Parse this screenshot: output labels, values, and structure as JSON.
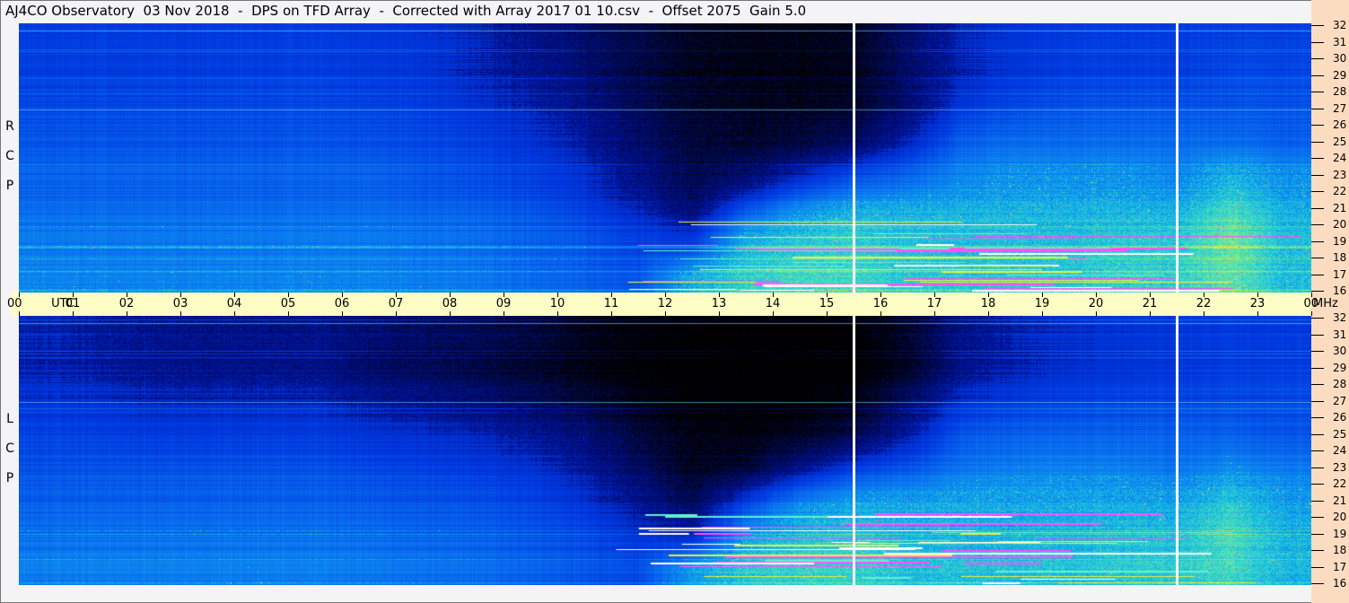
{
  "title": "AJ4CO Observatory  03 Nov 2018  -  DPS on TFD Array  -  Corrected with Array 2017 01 10.csv  -  Offset 2075  Gain 5.0",
  "chart_data": {
    "type": "heatmap",
    "title": "AJ4CO Observatory  03 Nov 2018  -  DPS on TFD Array  -  Corrected with Array 2017 01 10.csv  -  Offset 2075  Gain 5.0",
    "x_axis": {
      "label": "UTC",
      "range_hours": [
        0,
        24
      ],
      "ticks": [
        "00",
        "01",
        "02",
        "03",
        "04",
        "05",
        "06",
        "07",
        "08",
        "09",
        "10",
        "11",
        "12",
        "13",
        "14",
        "15",
        "16",
        "17",
        "18",
        "19",
        "20",
        "21",
        "22",
        "23",
        "00"
      ]
    },
    "y_axis": {
      "unit": "MHz",
      "range": [
        16,
        32
      ],
      "ticks": [
        "32",
        "31",
        "30",
        "29",
        "28",
        "27",
        "26",
        "25",
        "24",
        "23",
        "22",
        "21",
        "20",
        "19",
        "18",
        "17",
        "16"
      ]
    },
    "grid_freq_bands_mhz": [
      31,
      29,
      27,
      25,
      23,
      21,
      19,
      17
    ],
    "gap_markers_utc": [
      15.5,
      21.5
    ],
    "panels": [
      {
        "name": "RCP",
        "label": [
          "R",
          "C",
          "P"
        ],
        "intensity": [
          [
            0.35,
            0.35,
            0.35,
            0.35,
            0.35,
            0.35,
            0.34,
            0.33,
            0.3,
            0.25,
            0.2,
            0.15,
            0.1,
            0.08,
            0.08,
            0.1,
            0.2,
            0.3,
            0.33,
            0.35,
            0.35,
            0.35,
            0.36,
            0.36
          ],
          [
            0.36,
            0.36,
            0.36,
            0.36,
            0.36,
            0.36,
            0.35,
            0.34,
            0.3,
            0.27,
            0.22,
            0.15,
            0.1,
            0.08,
            0.08,
            0.1,
            0.2,
            0.3,
            0.34,
            0.36,
            0.36,
            0.36,
            0.38,
            0.38
          ],
          [
            0.38,
            0.38,
            0.38,
            0.38,
            0.38,
            0.38,
            0.37,
            0.36,
            0.33,
            0.3,
            0.25,
            0.18,
            0.12,
            0.1,
            0.1,
            0.12,
            0.22,
            0.35,
            0.38,
            0.4,
            0.4,
            0.4,
            0.4,
            0.4
          ],
          [
            0.4,
            0.4,
            0.4,
            0.4,
            0.4,
            0.4,
            0.39,
            0.38,
            0.36,
            0.33,
            0.28,
            0.2,
            0.14,
            0.12,
            0.14,
            0.2,
            0.3,
            0.42,
            0.44,
            0.44,
            0.44,
            0.44,
            0.44,
            0.42
          ],
          [
            0.42,
            0.42,
            0.42,
            0.42,
            0.42,
            0.42,
            0.42,
            0.4,
            0.38,
            0.36,
            0.32,
            0.24,
            0.16,
            0.2,
            0.3,
            0.38,
            0.42,
            0.48,
            0.5,
            0.5,
            0.5,
            0.48,
            0.55,
            0.5
          ],
          [
            0.44,
            0.44,
            0.44,
            0.44,
            0.44,
            0.44,
            0.44,
            0.43,
            0.42,
            0.4,
            0.36,
            0.3,
            0.22,
            0.4,
            0.5,
            0.55,
            0.55,
            0.56,
            0.56,
            0.56,
            0.56,
            0.55,
            0.65,
            0.55
          ],
          [
            0.46,
            0.46,
            0.46,
            0.46,
            0.46,
            0.46,
            0.46,
            0.45,
            0.44,
            0.42,
            0.4,
            0.36,
            0.35,
            0.55,
            0.6,
            0.62,
            0.58,
            0.58,
            0.58,
            0.58,
            0.6,
            0.6,
            0.7,
            0.58
          ],
          [
            0.48,
            0.48,
            0.48,
            0.48,
            0.48,
            0.48,
            0.48,
            0.47,
            0.46,
            0.44,
            0.42,
            0.4,
            0.55,
            0.62,
            0.64,
            0.64,
            0.6,
            0.6,
            0.6,
            0.6,
            0.62,
            0.62,
            0.68,
            0.58
          ]
        ]
      },
      {
        "name": "LCP",
        "label": [
          "L",
          "C",
          "P"
        ],
        "intensity": [
          [
            0.3,
            0.28,
            0.26,
            0.25,
            0.25,
            0.25,
            0.22,
            0.2,
            0.18,
            0.15,
            0.1,
            0.06,
            0.03,
            0.02,
            0.02,
            0.04,
            0.12,
            0.25,
            0.3,
            0.32,
            0.33,
            0.34,
            0.35,
            0.35
          ],
          [
            0.3,
            0.28,
            0.26,
            0.25,
            0.25,
            0.25,
            0.2,
            0.18,
            0.15,
            0.12,
            0.08,
            0.04,
            0.02,
            0.01,
            0.01,
            0.03,
            0.1,
            0.25,
            0.3,
            0.32,
            0.33,
            0.34,
            0.36,
            0.36
          ],
          [
            0.33,
            0.32,
            0.3,
            0.3,
            0.3,
            0.3,
            0.27,
            0.25,
            0.22,
            0.18,
            0.14,
            0.08,
            0.04,
            0.03,
            0.04,
            0.08,
            0.2,
            0.32,
            0.35,
            0.36,
            0.37,
            0.37,
            0.38,
            0.38
          ],
          [
            0.37,
            0.36,
            0.35,
            0.35,
            0.35,
            0.35,
            0.33,
            0.32,
            0.3,
            0.27,
            0.22,
            0.14,
            0.08,
            0.07,
            0.1,
            0.16,
            0.28,
            0.4,
            0.42,
            0.42,
            0.42,
            0.42,
            0.42,
            0.4
          ],
          [
            0.4,
            0.4,
            0.4,
            0.4,
            0.4,
            0.4,
            0.38,
            0.37,
            0.35,
            0.33,
            0.28,
            0.2,
            0.1,
            0.14,
            0.26,
            0.36,
            0.4,
            0.46,
            0.48,
            0.48,
            0.48,
            0.46,
            0.5,
            0.47
          ],
          [
            0.42,
            0.42,
            0.42,
            0.42,
            0.42,
            0.42,
            0.41,
            0.4,
            0.39,
            0.37,
            0.33,
            0.26,
            0.18,
            0.36,
            0.48,
            0.53,
            0.53,
            0.54,
            0.54,
            0.54,
            0.54,
            0.53,
            0.6,
            0.52
          ],
          [
            0.45,
            0.45,
            0.45,
            0.45,
            0.45,
            0.45,
            0.44,
            0.43,
            0.42,
            0.4,
            0.38,
            0.33,
            0.3,
            0.52,
            0.58,
            0.6,
            0.56,
            0.56,
            0.56,
            0.56,
            0.58,
            0.58,
            0.66,
            0.56
          ],
          [
            0.47,
            0.47,
            0.47,
            0.47,
            0.47,
            0.47,
            0.46,
            0.45,
            0.44,
            0.42,
            0.4,
            0.38,
            0.52,
            0.6,
            0.62,
            0.62,
            0.58,
            0.58,
            0.58,
            0.58,
            0.6,
            0.6,
            0.64,
            0.56
          ]
        ]
      }
    ],
    "colormap": [
      "#000000",
      "#001090",
      "#0038e0",
      "#0a70f0",
      "#10b0e8",
      "#40e0c0",
      "#e0f040",
      "#ff40ff"
    ]
  },
  "timebar": {
    "utc_label": "UTC",
    "mhz_label": "MHz"
  }
}
